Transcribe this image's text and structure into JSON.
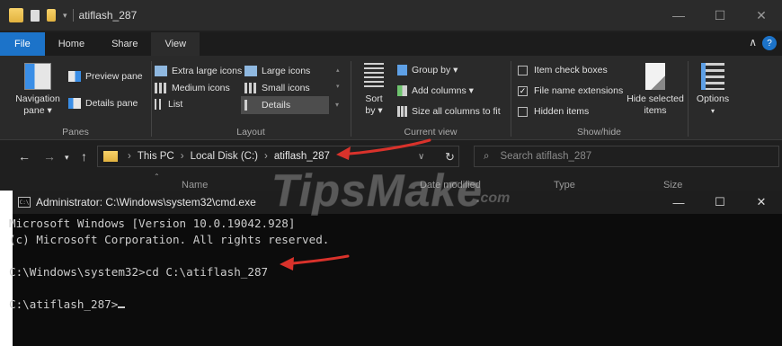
{
  "explorer": {
    "title": "atiflash_287",
    "tabs": [
      "File",
      "Home",
      "Share",
      "View"
    ],
    "ribbon": {
      "panes": {
        "label": "Panes",
        "navigation_pane": "Navigation pane ▾",
        "preview_pane": "Preview pane",
        "details_pane": "Details pane"
      },
      "layout": {
        "label": "Layout",
        "items": [
          "Extra large icons",
          "Large icons",
          "Medium icons",
          "Small icons",
          "List",
          "Details"
        ]
      },
      "current_view": {
        "label": "Current view",
        "sort_by": "Sort by ▾",
        "group_by": "Group by ▾",
        "add_columns": "Add columns ▾",
        "size_all": "Size all columns to fit"
      },
      "show_hide": {
        "label": "Show/hide",
        "item_check_boxes": "Item check boxes",
        "file_name_extensions": "File name extensions",
        "hidden_items": "Hidden items",
        "hide_selected": "Hide selected items",
        "file_name_extensions_checked": true
      },
      "options": "Options"
    },
    "address": {
      "crumbs": [
        "This PC",
        "Local Disk (C:)",
        "atiflash_287"
      ]
    },
    "search_placeholder": "Search atiflash_287",
    "columns": [
      "Name",
      "Date modified",
      "Type",
      "Size"
    ]
  },
  "cmd": {
    "title": "Administrator: C:\\Windows\\system32\\cmd.exe",
    "lines": [
      "Microsoft Windows [Version 10.0.19042.928]",
      "(c) Microsoft Corporation. All rights reserved.",
      "",
      "C:\\Windows\\system32>cd C:\\atiflash_287",
      "",
      "C:\\atiflash_287>"
    ]
  },
  "watermark": "TipsMake",
  "watermark_suffix": ".com",
  "colors": {
    "file_tab": "#1c73c9",
    "arrow": "#d9322b"
  }
}
